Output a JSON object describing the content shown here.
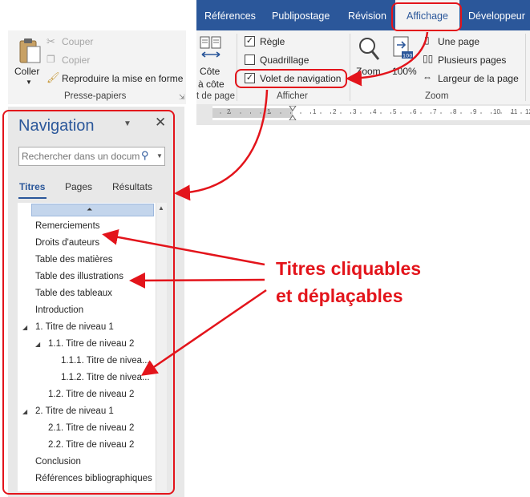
{
  "ribbon": {
    "tabs": [
      {
        "label": "Références",
        "active": false
      },
      {
        "label": "Publipostage",
        "active": false
      },
      {
        "label": "Révision",
        "active": false
      },
      {
        "label": "Affichage",
        "active": true
      },
      {
        "label": "Développeur",
        "active": false
      }
    ],
    "clipboard": {
      "paste_label": "Coller",
      "cut_label": "Couper",
      "copy_label": "Copier",
      "format_painter_label": "Reproduire la mise en forme",
      "group_label": "Presse-papiers"
    },
    "views": {
      "side_by_side_line1": "Côte",
      "side_by_side_line2": "à côte",
      "group_label_partial": "t de page"
    },
    "show": {
      "ruler_label": "Règle",
      "ruler_checked": true,
      "gridlines_label": "Quadrillage",
      "gridlines_checked": false,
      "navpane_label": "Volet de navigation",
      "navpane_checked": true,
      "group_label": "Afficher"
    },
    "zoom": {
      "zoom_label": "Zoom",
      "hundred_label": "100%",
      "one_page_label": "Une page",
      "multi_pages_label": "Plusieurs pages",
      "page_width_label": "Largeur de la page",
      "group_label": "Zoom"
    }
  },
  "ruler": {
    "labels": [
      "2",
      "1",
      "1",
      "2",
      "3",
      "4",
      "5",
      "6",
      "7",
      "8",
      "9",
      "10",
      "11",
      "12",
      "13"
    ]
  },
  "navigation": {
    "title": "Navigation",
    "search_placeholder": "Rechercher dans un docum",
    "tabs": [
      {
        "label": "Titres",
        "selected": true
      },
      {
        "label": "Pages",
        "selected": false
      },
      {
        "label": "Résultats",
        "selected": false
      }
    ],
    "headings": [
      {
        "label": "Remerciements",
        "level": 1,
        "expand": false
      },
      {
        "label": "Droits d'auteurs",
        "level": 1,
        "expand": false
      },
      {
        "label": "Table des matières",
        "level": 1,
        "expand": false
      },
      {
        "label": "Table des illustrations",
        "level": 1,
        "expand": false
      },
      {
        "label": "Table des tableaux",
        "level": 1,
        "expand": false
      },
      {
        "label": "Introduction",
        "level": 1,
        "expand": false
      },
      {
        "label": "1. Titre de niveau 1",
        "level": 1,
        "expand": true
      },
      {
        "label": "1.1. Titre de niveau 2",
        "level": 2,
        "expand": true
      },
      {
        "label": "1.1.1. Titre de nivea...",
        "level": 3,
        "expand": false
      },
      {
        "label": "1.1.2. Titre de nivea...",
        "level": 3,
        "expand": false
      },
      {
        "label": "1.2. Titre de niveau 2",
        "level": 2,
        "expand": false
      },
      {
        "label": "2. Titre de niveau 1",
        "level": 1,
        "expand": true
      },
      {
        "label": "2.1. Titre de niveau 2",
        "level": 2,
        "expand": false
      },
      {
        "label": "2.2. Titre de niveau 2",
        "level": 2,
        "expand": false
      },
      {
        "label": "Conclusion",
        "level": 1,
        "expand": false
      },
      {
        "label": "Références bibliographiques",
        "level": 1,
        "expand": false
      }
    ]
  },
  "annotation": {
    "line1": "Titres cliquables",
    "line2": "et déplaçables",
    "color": "#e3141b"
  },
  "colors": {
    "word_blue": "#2b579a",
    "ribbon_bg": "#f3f3f3",
    "pane_bg": "#e8e8e8"
  }
}
